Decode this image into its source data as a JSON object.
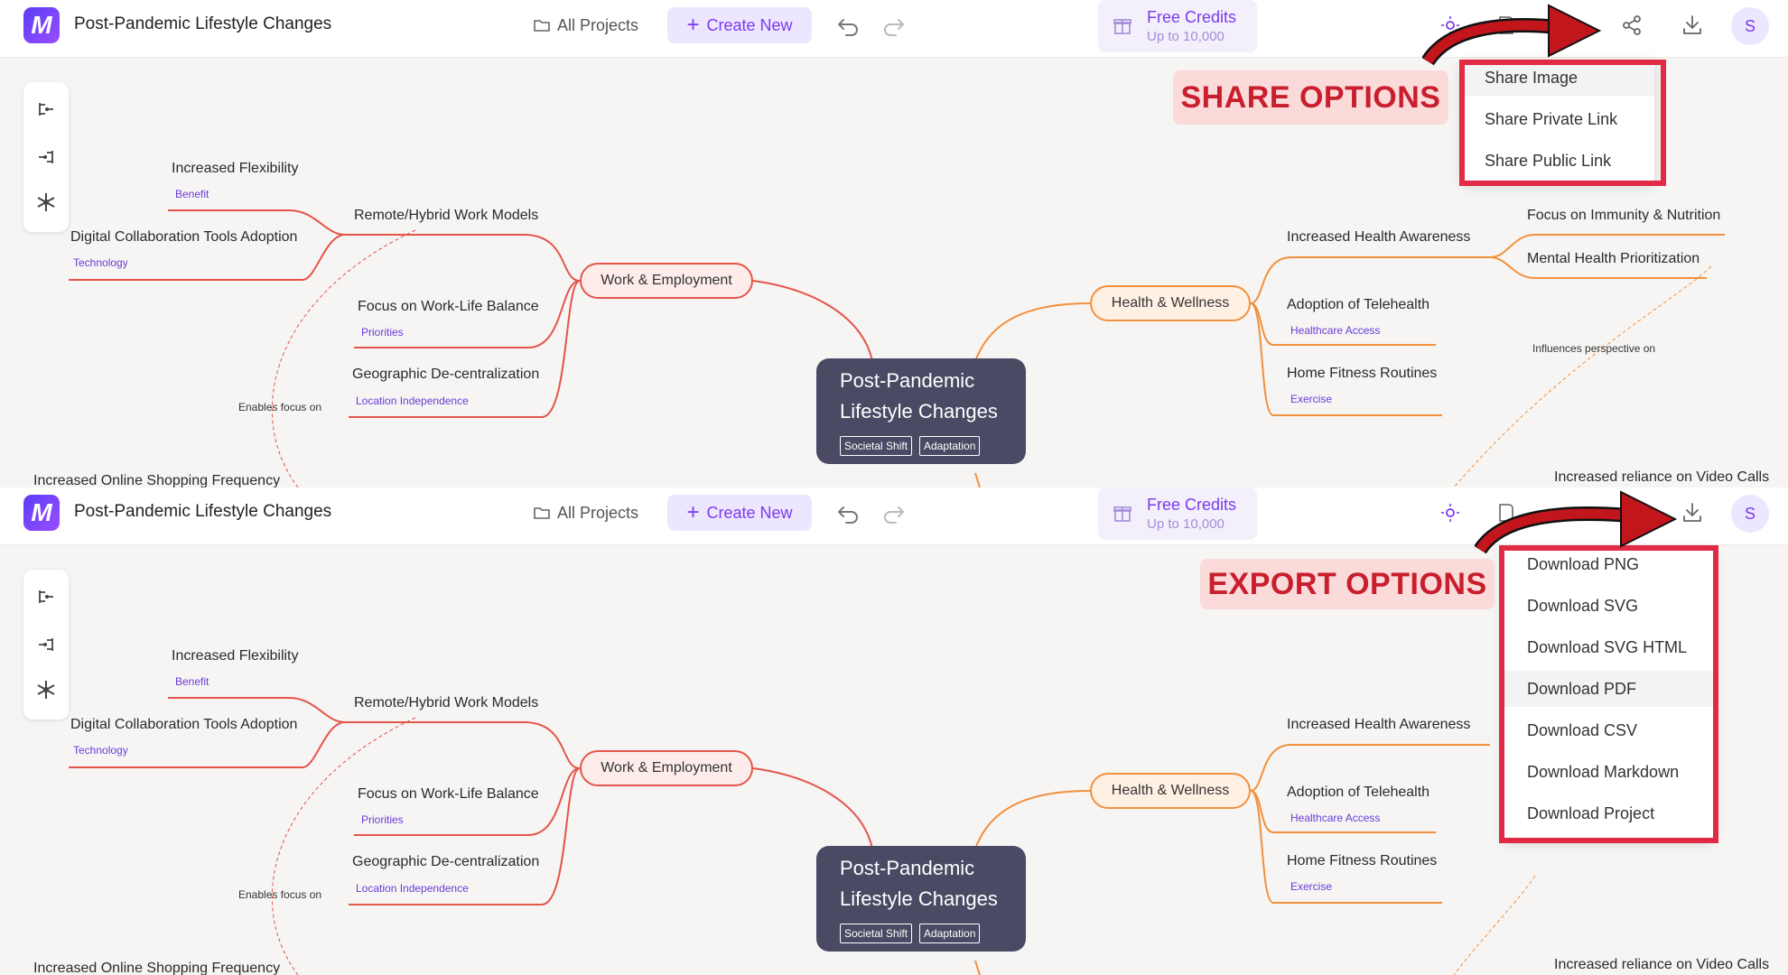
{
  "header": {
    "title": "Post-Pandemic Lifestyle Changes",
    "all_projects": "All Projects",
    "create_new": "Create New",
    "credits_title": "Free Credits",
    "credits_subtitle": "Up to 10,000",
    "avatar_initial": "S"
  },
  "mindmap": {
    "root": {
      "title": "Post-Pandemic\nLifestyle Changes",
      "tags": [
        "Societal Shift",
        "Adaptation"
      ]
    },
    "branches": {
      "work": "Work & Employment",
      "health": "Health & Wellness"
    },
    "work_leaves": {
      "flexibility": {
        "label": "Increased Flexibility",
        "tag": "Benefit"
      },
      "remote": {
        "label": "Remote/Hybrid Work Models"
      },
      "collab": {
        "label": "Digital Collaboration Tools Adoption",
        "tag": "Technology"
      },
      "balance": {
        "label": "Focus on Work-Life Balance",
        "tag": "Priorities"
      },
      "geo": {
        "label": "Geographic De-centralization",
        "tag": "Location Independence"
      }
    },
    "health_leaves": {
      "awareness": {
        "label": "Increased Health Awareness"
      },
      "immunity": {
        "label": "Focus on Immunity & Nutrition"
      },
      "mental": {
        "label": "Mental Health Prioritization"
      },
      "telehealth": {
        "label": "Adoption of Telehealth",
        "tag": "Healthcare Access"
      },
      "fitness": {
        "label": "Home Fitness Routines",
        "tag": "Exercise"
      }
    },
    "relations": {
      "enables": "Enables focus on",
      "influences": "Influences perspective on"
    },
    "bottom_edge": {
      "shopping": "Increased Online Shopping Frequency",
      "video": "Increased reliance on Video Calls"
    }
  },
  "share_menu": {
    "callout": "SHARE OPTIONS",
    "items": [
      "Share Image",
      "Share Private Link",
      "Share Public Link"
    ]
  },
  "export_menu": {
    "callout": "EXPORT OPTIONS",
    "items": [
      "Download PNG",
      "Download SVG",
      "Download SVG HTML",
      "Download PDF",
      "Download CSV",
      "Download Markdown",
      "Download Project"
    ]
  },
  "colors": {
    "accent": "#7c3aed",
    "work_branch": "#e4554a",
    "health_branch": "#f1903d",
    "root": "#4a4a64",
    "annotation_red": "#e12a44"
  }
}
